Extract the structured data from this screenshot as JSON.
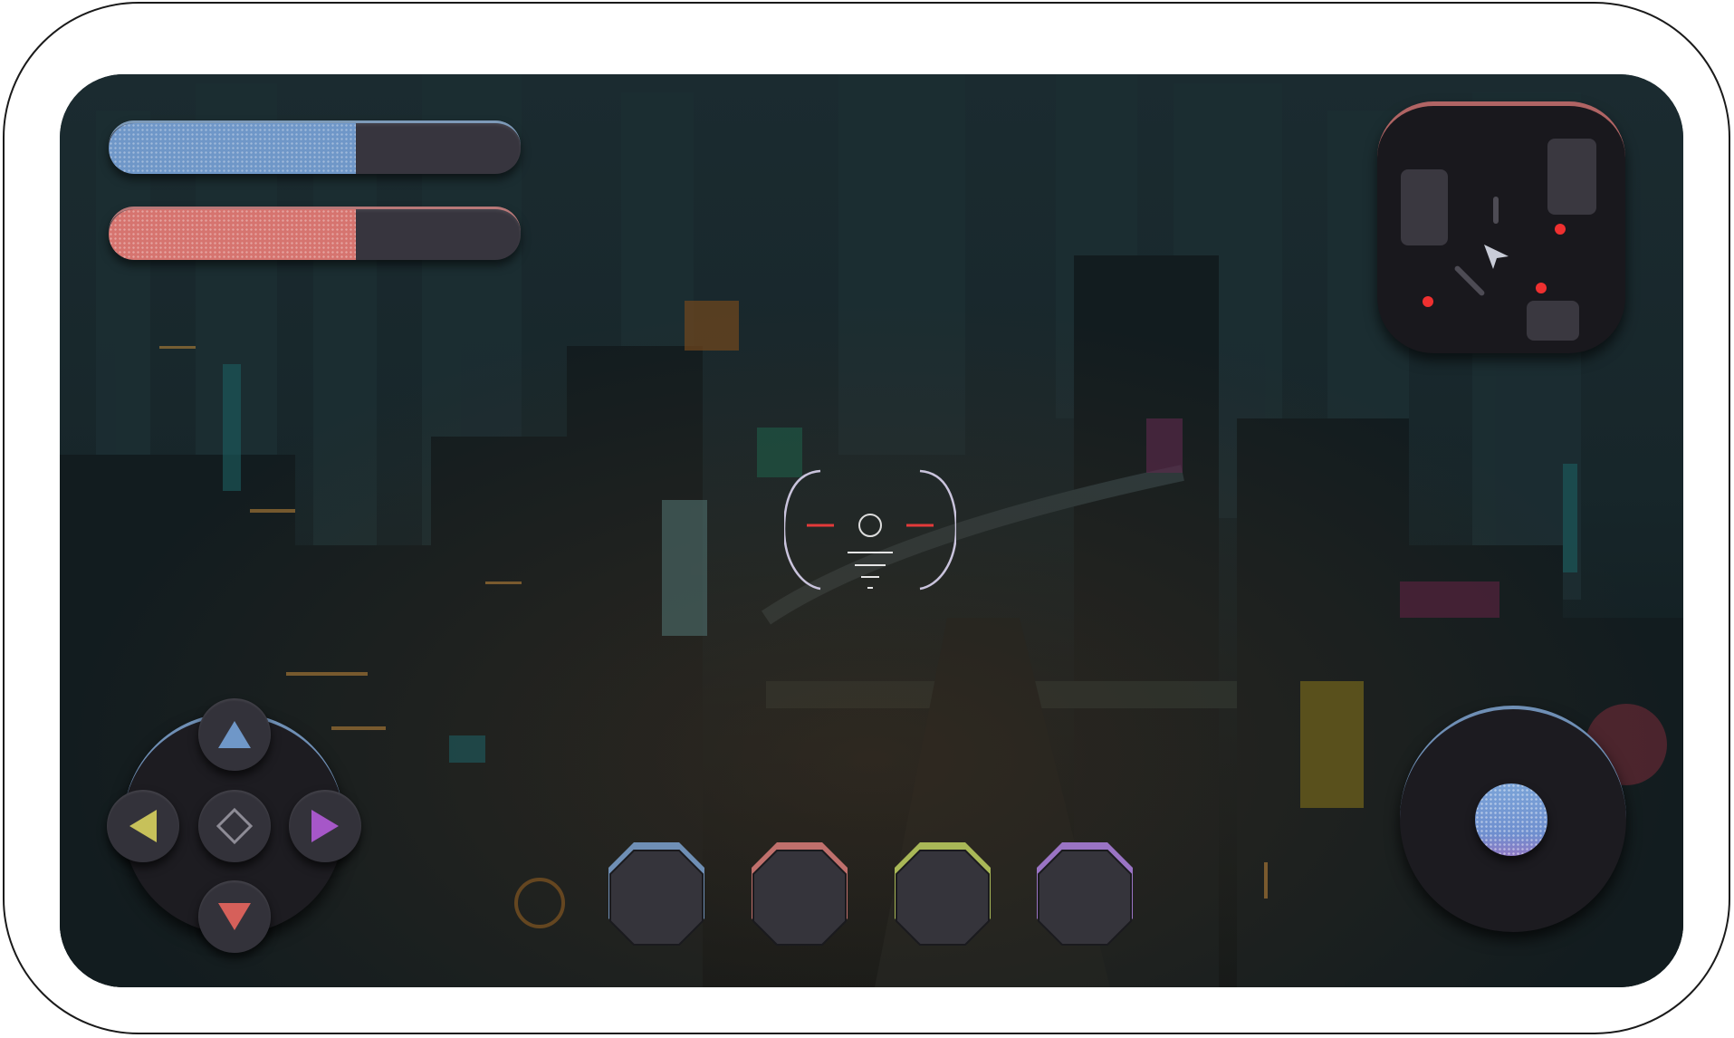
{
  "hud": {
    "health": {
      "fraction": 0.6,
      "color": "#6f97c8"
    },
    "energy": {
      "fraction": 0.6,
      "color": "#d6746f"
    }
  },
  "minimap": {
    "enemies": 3,
    "player_icon": "cursor-arrow-icon"
  },
  "crosshair": {
    "icon": "reticle-icon",
    "accent": "#e33a3a"
  },
  "dpad": {
    "up_icon": "triangle-up-icon",
    "left_icon": "triangle-left-icon",
    "right_icon": "triangle-right-icon",
    "down_icon": "triangle-down-icon",
    "center_icon": "diamond-icon",
    "colors": {
      "up": "#6f97c8",
      "left": "#c7c15a",
      "right": "#a657c8",
      "down": "#d6605a"
    }
  },
  "skills": [
    {
      "name": "slot-1",
      "accent": "#6f8fb5"
    },
    {
      "name": "slot-2",
      "accent": "#c0706c"
    },
    {
      "name": "slot-3",
      "accent": "#a9b857"
    },
    {
      "name": "slot-4",
      "accent": "#9a74c4"
    }
  ],
  "joystick": {
    "knob_color": "#7ba4d8"
  }
}
